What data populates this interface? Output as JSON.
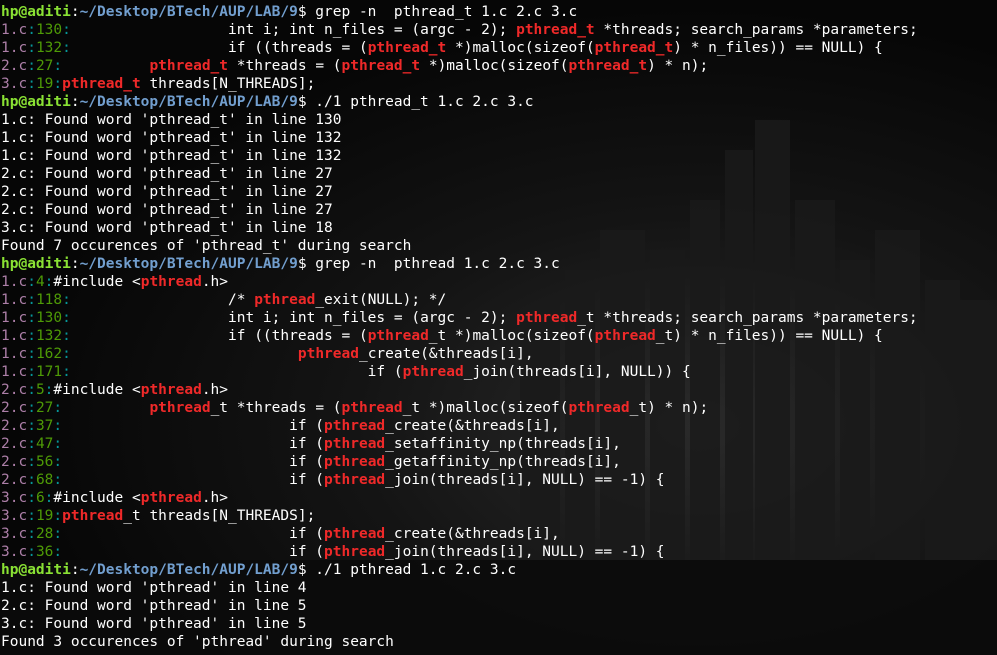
{
  "colors": {
    "prompt_user": "#8ae234",
    "prompt_path": "#729fcf",
    "grep_filename": "#ad7fa8",
    "grep_separator": "#06989a",
    "grep_match": "#ef2929",
    "text": "#ffffff"
  },
  "lines": [
    {
      "k": "prompt",
      "user": "hp@aditi",
      "path": "~/Desktop/BTech/AUP/LAB/9",
      "cmd": "grep -n  pthread_t 1.c 2.c 3.c"
    },
    {
      "k": "grep",
      "file": "1.c",
      "num": "130",
      "parts": [
        [
          "                  int i; int n_files = (argc - 2); ",
          0
        ],
        [
          "pthread_t",
          1
        ],
        [
          " *threads; search_params *parameters;",
          0
        ]
      ]
    },
    {
      "k": "grep",
      "file": "1.c",
      "num": "132",
      "parts": [
        [
          "                  if ((threads = (",
          0
        ],
        [
          "pthread_t",
          1
        ],
        [
          " *)malloc(sizeof(",
          0
        ],
        [
          "pthread_t",
          1
        ],
        [
          ") * n_files)) == NULL) {",
          0
        ]
      ]
    },
    {
      "k": "grep",
      "file": "2.c",
      "num": "27",
      "parts": [
        [
          "          ",
          0
        ],
        [
          "pthread_t",
          1
        ],
        [
          " *threads = (",
          0
        ],
        [
          "pthread_t",
          1
        ],
        [
          " *)malloc(sizeof(",
          0
        ],
        [
          "pthread_t",
          1
        ],
        [
          ") * n);",
          0
        ]
      ]
    },
    {
      "k": "grep",
      "file": "3.c",
      "num": "19",
      "parts": [
        [
          "pthread_t",
          1
        ],
        [
          " threads[N_THREADS];",
          0
        ]
      ]
    },
    {
      "k": "prompt",
      "user": "hp@aditi",
      "path": "~/Desktop/BTech/AUP/LAB/9",
      "cmd": "./1 pthread_t 1.c 2.c 3.c"
    },
    {
      "k": "text",
      "text": "1.c: Found word 'pthread_t' in line 130"
    },
    {
      "k": "text",
      "text": "1.c: Found word 'pthread_t' in line 132"
    },
    {
      "k": "text",
      "text": "1.c: Found word 'pthread_t' in line 132"
    },
    {
      "k": "text",
      "text": "2.c: Found word 'pthread_t' in line 27"
    },
    {
      "k": "text",
      "text": "2.c: Found word 'pthread_t' in line 27"
    },
    {
      "k": "text",
      "text": "2.c: Found word 'pthread_t' in line 27"
    },
    {
      "k": "text",
      "text": "3.c: Found word 'pthread_t' in line 18"
    },
    {
      "k": "text",
      "text": "Found 7 occurences of 'pthread_t' during search"
    },
    {
      "k": "prompt",
      "user": "hp@aditi",
      "path": "~/Desktop/BTech/AUP/LAB/9",
      "cmd": "grep -n  pthread 1.c 2.c 3.c"
    },
    {
      "k": "grep",
      "file": "1.c",
      "num": "4",
      "parts": [
        [
          "#include <",
          0
        ],
        [
          "pthread",
          1
        ],
        [
          ".h>",
          0
        ]
      ]
    },
    {
      "k": "grep",
      "file": "1.c",
      "num": "118",
      "parts": [
        [
          "                  /* ",
          0
        ],
        [
          "pthread",
          1
        ],
        [
          "_exit(NULL); */",
          0
        ]
      ]
    },
    {
      "k": "grep",
      "file": "1.c",
      "num": "130",
      "parts": [
        [
          "                  int i; int n_files = (argc - 2); ",
          0
        ],
        [
          "pthread",
          1
        ],
        [
          "_t *threads; search_params *parameters;",
          0
        ]
      ]
    },
    {
      "k": "grep",
      "file": "1.c",
      "num": "132",
      "parts": [
        [
          "                  if ((threads = (",
          0
        ],
        [
          "pthread",
          1
        ],
        [
          "_t *)malloc(sizeof(",
          0
        ],
        [
          "pthread",
          1
        ],
        [
          "_t) * n_files)) == NULL) {",
          0
        ]
      ]
    },
    {
      "k": "grep",
      "file": "1.c",
      "num": "162",
      "parts": [
        [
          "                          ",
          0
        ],
        [
          "pthread",
          1
        ],
        [
          "_create(&threads[i],",
          0
        ]
      ]
    },
    {
      "k": "grep",
      "file": "1.c",
      "num": "171",
      "parts": [
        [
          "                                  if (",
          0
        ],
        [
          "pthread",
          1
        ],
        [
          "_join(threads[i], NULL)) {",
          0
        ]
      ]
    },
    {
      "k": "grep",
      "file": "2.c",
      "num": "5",
      "parts": [
        [
          "#include <",
          0
        ],
        [
          "pthread",
          1
        ],
        [
          ".h>",
          0
        ]
      ]
    },
    {
      "k": "grep",
      "file": "2.c",
      "num": "27",
      "parts": [
        [
          "          ",
          0
        ],
        [
          "pthread",
          1
        ],
        [
          "_t *threads = (",
          0
        ],
        [
          "pthread",
          1
        ],
        [
          "_t *)malloc(sizeof(",
          0
        ],
        [
          "pthread",
          1
        ],
        [
          "_t) * n);",
          0
        ]
      ]
    },
    {
      "k": "grep",
      "file": "2.c",
      "num": "37",
      "parts": [
        [
          "                          if (",
          0
        ],
        [
          "pthread",
          1
        ],
        [
          "_create(&threads[i],",
          0
        ]
      ]
    },
    {
      "k": "grep",
      "file": "2.c",
      "num": "47",
      "parts": [
        [
          "                          if (",
          0
        ],
        [
          "pthread",
          1
        ],
        [
          "_setaffinity_np(threads[i],",
          0
        ]
      ]
    },
    {
      "k": "grep",
      "file": "2.c",
      "num": "56",
      "parts": [
        [
          "                          if (",
          0
        ],
        [
          "pthread",
          1
        ],
        [
          "_getaffinity_np(threads[i],",
          0
        ]
      ]
    },
    {
      "k": "grep",
      "file": "2.c",
      "num": "68",
      "parts": [
        [
          "                          if (",
          0
        ],
        [
          "pthread",
          1
        ],
        [
          "_join(threads[i], NULL) == -1) {",
          0
        ]
      ]
    },
    {
      "k": "grep",
      "file": "3.c",
      "num": "6",
      "parts": [
        [
          "#include <",
          0
        ],
        [
          "pthread",
          1
        ],
        [
          ".h>",
          0
        ]
      ]
    },
    {
      "k": "grep",
      "file": "3.c",
      "num": "19",
      "parts": [
        [
          "pthread",
          1
        ],
        [
          "_t threads[N_THREADS];",
          0
        ]
      ]
    },
    {
      "k": "grep",
      "file": "3.c",
      "num": "28",
      "parts": [
        [
          "                          if (",
          0
        ],
        [
          "pthread",
          1
        ],
        [
          "_create(&threads[i],",
          0
        ]
      ]
    },
    {
      "k": "grep",
      "file": "3.c",
      "num": "36",
      "parts": [
        [
          "                          if (",
          0
        ],
        [
          "pthread",
          1
        ],
        [
          "_join(threads[i], NULL) == -1) {",
          0
        ]
      ]
    },
    {
      "k": "prompt",
      "user": "hp@aditi",
      "path": "~/Desktop/BTech/AUP/LAB/9",
      "cmd": "./1 pthread 1.c 2.c 3.c"
    },
    {
      "k": "text",
      "text": "1.c: Found word 'pthread' in line 4"
    },
    {
      "k": "text",
      "text": "2.c: Found word 'pthread' in line 5"
    },
    {
      "k": "text",
      "text": "3.c: Found word 'pthread' in line 5"
    },
    {
      "k": "text",
      "text": "Found 3 occurences of 'pthread' during search"
    }
  ]
}
